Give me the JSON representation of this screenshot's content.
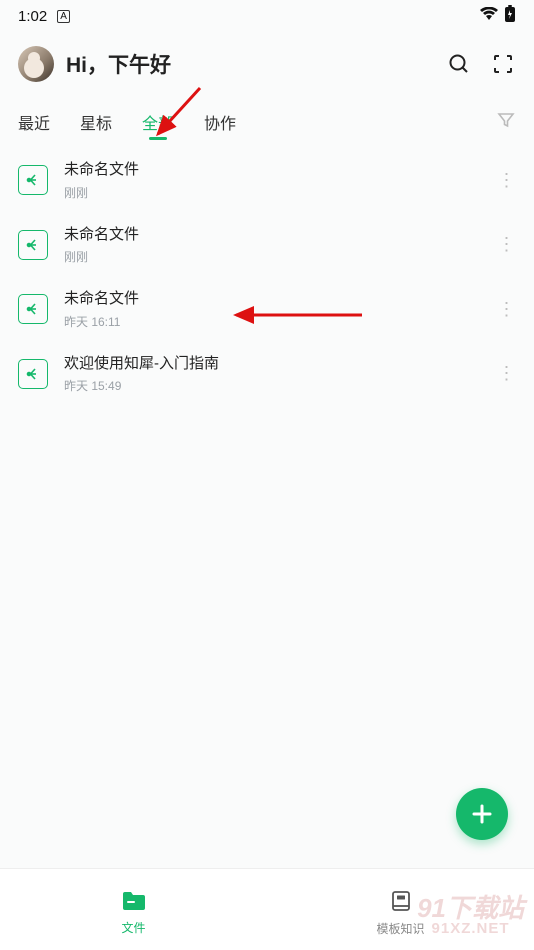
{
  "status": {
    "time": "1:02",
    "indicator": "A"
  },
  "header": {
    "greeting": "Hi，下午好"
  },
  "tabs": {
    "items": [
      {
        "label": "最近",
        "active": false
      },
      {
        "label": "星标",
        "active": false
      },
      {
        "label": "全部",
        "active": true
      },
      {
        "label": "协作",
        "active": false
      }
    ]
  },
  "files": [
    {
      "title": "未命名文件",
      "time": "刚刚"
    },
    {
      "title": "未命名文件",
      "time": "刚刚"
    },
    {
      "title": "未命名文件",
      "time": "昨天 16:11"
    },
    {
      "title": "欢迎使用知犀-入门指南",
      "time": "昨天 15:49"
    }
  ],
  "bottomNav": {
    "items": [
      {
        "label": "文件",
        "active": true
      },
      {
        "label": "模板知识",
        "active": false
      }
    ]
  },
  "watermark": {
    "line1": "91下载站",
    "line2": "91XZ.NET"
  }
}
